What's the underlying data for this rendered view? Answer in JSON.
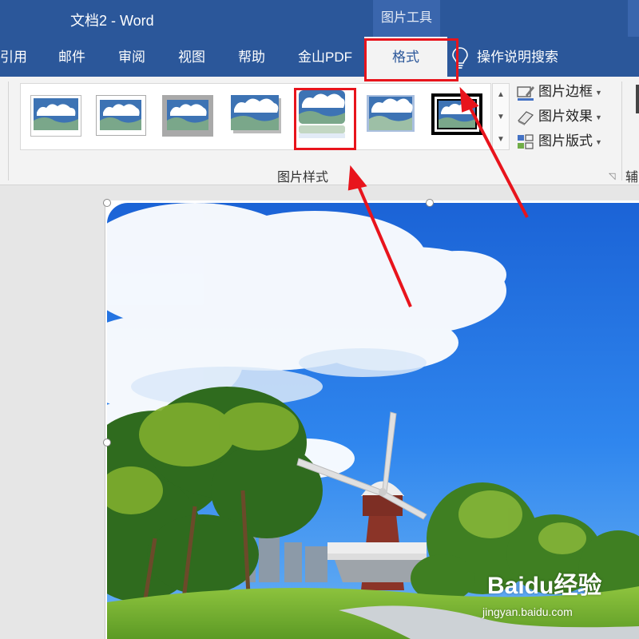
{
  "window": {
    "title": "文档2  -  Word",
    "context_tool": "图片工具"
  },
  "tabs": [
    {
      "label": "引用",
      "active": false
    },
    {
      "label": "邮件",
      "active": false
    },
    {
      "label": "审阅",
      "active": false
    },
    {
      "label": "视图",
      "active": false
    },
    {
      "label": "帮助",
      "active": false
    },
    {
      "label": "金山PDF",
      "active": false
    },
    {
      "label": "格式",
      "active": true
    }
  ],
  "tell_me": {
    "label": "操作说明搜索",
    "icon": "lightbulb-icon"
  },
  "ribbon": {
    "picture_styles": {
      "group_label": "图片样式",
      "styles": [
        {
          "name": "simple-frame-white"
        },
        {
          "name": "simple-frame-white-shadow"
        },
        {
          "name": "thick-matte-gray"
        },
        {
          "name": "drop-shadow-rectangle"
        },
        {
          "name": "reflected-rounded-rectangle"
        },
        {
          "name": "soft-edge-rectangle"
        },
        {
          "name": "double-frame-black"
        }
      ]
    },
    "commands": [
      {
        "label": "图片边框",
        "icon": "picture-border-icon"
      },
      {
        "label": "图片效果",
        "icon": "picture-effects-icon"
      },
      {
        "label": "图片版式",
        "icon": "picture-layout-icon"
      }
    ],
    "next_group_label": "辅"
  },
  "watermark": {
    "brand": "Baidu经验",
    "url": "jingyan.baidu.com"
  },
  "colors": {
    "title_bar": "#2b579a",
    "accent_red": "#e8141c",
    "ribbon_bg": "#f3f3f3"
  }
}
